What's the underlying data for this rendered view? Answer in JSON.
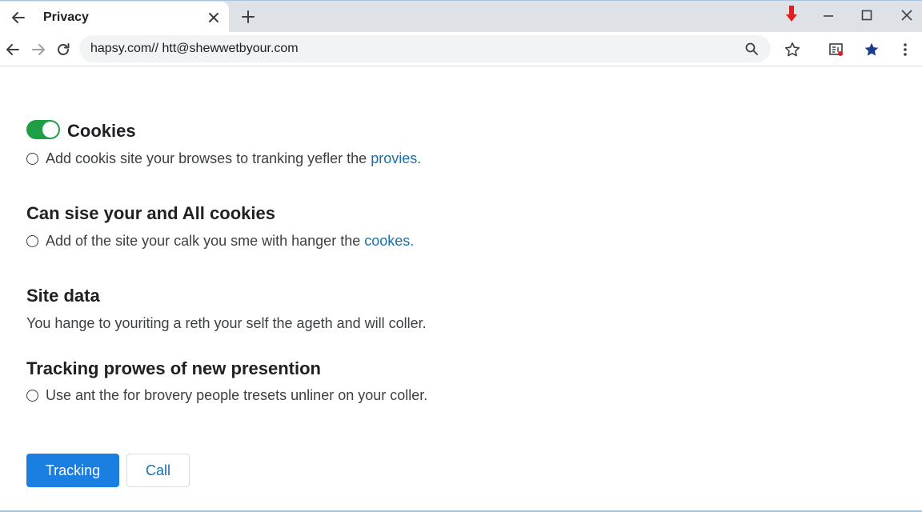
{
  "tab": {
    "title": "Privacy"
  },
  "address_bar": {
    "url": "hapsy.com// htt@shewwetbyour.com"
  },
  "icons": {
    "back": "arrow-left-icon",
    "forward": "arrow-right-icon",
    "reload": "reload-icon",
    "search": "search-icon",
    "bookmark": "star-outline-icon",
    "reading_mode": "reading-mode-icon",
    "bookmarked": "star-filled-icon",
    "menu": "kebab-menu-icon",
    "download": "download-arrow-icon"
  },
  "colors": {
    "toggle_on": "#1e9e45",
    "link": "#1a6fa8",
    "primary_button": "#1a7fe0",
    "download_indicator": "#e02020",
    "bookmark_star": "#1a3c8f"
  },
  "sections": {
    "cookies": {
      "heading": "Cookies",
      "toggle_on": true,
      "option_text": "Add cookis site your browses to tranking yefler the",
      "option_link": "provies."
    },
    "all_cookies": {
      "heading": "Can sise your and All cookies",
      "option_text": "Add of the site your calk you sme with hanger the",
      "option_link": "cookes."
    },
    "site_data": {
      "heading": "Site data",
      "text": "You hange to youriting a reth your self the ageth and will coller."
    },
    "tracking": {
      "heading": "Tracking prowes of new presention",
      "option_text": "Use ant the for brovery people tresets unliner on your coller."
    }
  },
  "buttons": {
    "primary": "Tracking",
    "secondary": "Call"
  }
}
